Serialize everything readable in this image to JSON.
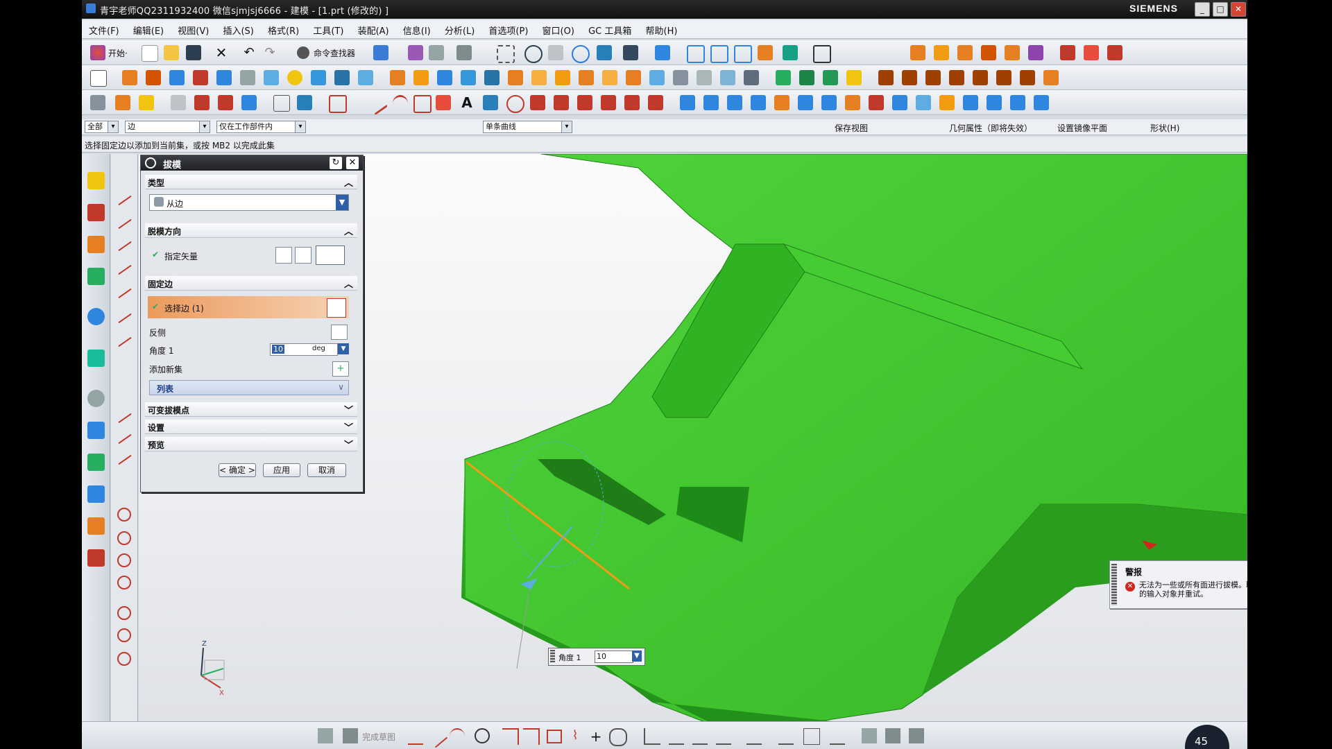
{
  "window": {
    "title": "青宇老师QQ2311932400 微信sjmjsj6666 - 建模 - [1.prt  (修改的) ]",
    "brand": "SIEMENS",
    "buttons": [
      "_",
      "□",
      "✕"
    ]
  },
  "menu": [
    "文件(F)",
    "编辑(E)",
    "视图(V)",
    "插入(S)",
    "格式(R)",
    "工具(T)",
    "装配(A)",
    "信息(I)",
    "分析(L)",
    "首选项(P)",
    "窗口(O)",
    "GC 工具箱",
    "帮助(H)"
  ],
  "toolbar1": {
    "start_label": "开始·",
    "finder_label": "命令查找器"
  },
  "selection_bar": {
    "filter_all": "全部",
    "filter_edge": "边",
    "scope": "仅在工作部件内",
    "curve_rule": "单条曲线",
    "save_view": "保存视图",
    "geom_props": "几何属性（即将失效）",
    "mirror_plane": "设置镜像平面",
    "shape": "形状(H)"
  },
  "cue_line": "选择固定边以添加到当前集，或按 MB2 以完成此集",
  "dialog": {
    "title": "拔模",
    "section_type": "类型",
    "type_value": "从边",
    "section_direction": "脱模方向",
    "specify_vector": "指定矢量",
    "section_fixed": "固定边",
    "select_edge": "选择边 (1)",
    "reverse": "反侧",
    "angle_label": "角度 1",
    "angle_value": "10",
    "angle_unit": "deg",
    "add_new_set": "添加新集",
    "list": "列表",
    "section_variable": "可变拔模点",
    "section_settings": "设置",
    "section_preview": "预览",
    "ok": "< 确定 >",
    "apply": "应用",
    "cancel": "取消"
  },
  "angle_popup": {
    "label": "角度 1",
    "value": "10"
  },
  "alert": {
    "title": "警报",
    "message": "无法为一些或所有面进行拔模。取消选择失败的输入对象并重试。"
  },
  "bottom": {
    "finish_sketch": "完成草图",
    "zoom": "45"
  },
  "triad": {
    "z": "Z",
    "x": "X"
  },
  "colors": {
    "model": "#3cc42b",
    "edge_highlight": "#f39c12",
    "error": "#d0291c"
  }
}
